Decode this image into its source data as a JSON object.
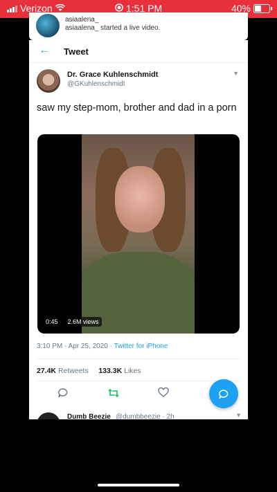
{
  "status_bar": {
    "carrier": "Verizon",
    "time": "1:51 PM",
    "battery": "40%",
    "battery_level": 0.4,
    "color": "#e8303a"
  },
  "live_notification": {
    "username": "asiaalena_",
    "message": "asiaalena_ started a live video."
  },
  "nav": {
    "back_icon": "arrow-left-icon",
    "title": "Tweet"
  },
  "tweet": {
    "author_name": "Dr. Grace Kuhlenschmidt",
    "author_handle": "@GKuhlenschmidt",
    "text": "saw my step-mom, brother and dad in a porn",
    "video": {
      "duration": "0:45",
      "views": "2.6M views"
    },
    "timestamp": "3:10 PM · Apr 25, 2020 · ",
    "source": "Twitter for iPhone",
    "retweets_count": "27.4K",
    "retweets_label": "Retweets",
    "likes_count": "133.3K",
    "likes_label": "Likes",
    "accent": "#1da1f2"
  },
  "actions": {
    "reply_icon": "reply-icon",
    "retweet_icon": "retweet-icon",
    "like_icon": "heart-icon",
    "compose_icon": "compose-icon"
  },
  "next_tweet": {
    "author_name": "Dumb Beezie",
    "author_handle": "@dumbbeezie · 2h"
  }
}
